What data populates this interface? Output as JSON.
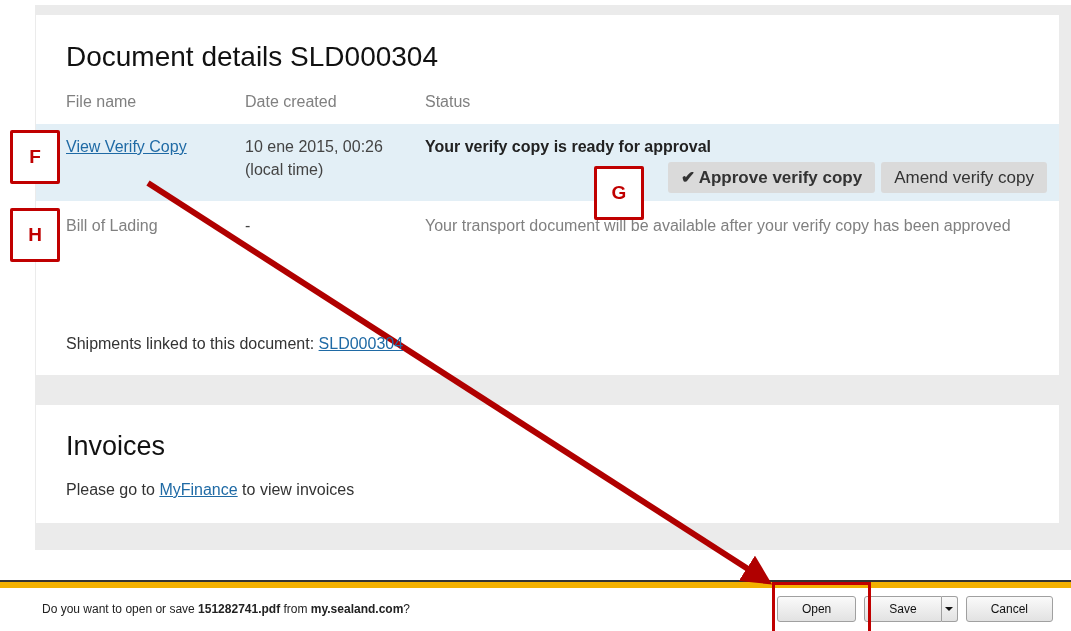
{
  "document_details": {
    "title": "Document details SLD000304",
    "columns": [
      "File name",
      "Date created",
      "Status"
    ],
    "rows": [
      {
        "kind": "ready",
        "file_name": "View Verify Copy",
        "date": "10 ene 2015, 00:26",
        "date_note": "(local time)",
        "status": "Your verify copy is ready for approval",
        "selected": true,
        "buttons": [
          {
            "kind": "approve",
            "label": "Approve verify copy",
            "icon": "✔"
          },
          {
            "kind": "amend",
            "label": "Amend verify copy"
          }
        ]
      },
      {
        "kind": "pending",
        "file_name": "Bill of Lading",
        "date": "-",
        "status": "Your transport document will be available after your verify copy has been approved",
        "selected": false
      }
    ],
    "shipments_label": "Shipments linked to this document:",
    "shipments_link": "SLD000304"
  },
  "invoices": {
    "title": "Invoices",
    "text_before": "Please go to",
    "link": "MyFinance",
    "text_after": "to view invoices"
  },
  "download_bar": {
    "message": "Do you want to open or save **151282741.pdf** from **my.sealand.com**?",
    "buttons": [
      {
        "kind": "open",
        "label": "Open"
      },
      {
        "kind": "save",
        "label": "Save"
      },
      {
        "kind": "cancel",
        "label": "Cancel"
      }
    ]
  },
  "callouts": [
    {
      "label": "F"
    },
    {
      "label": "H"
    },
    {
      "label": "G"
    }
  ]
}
